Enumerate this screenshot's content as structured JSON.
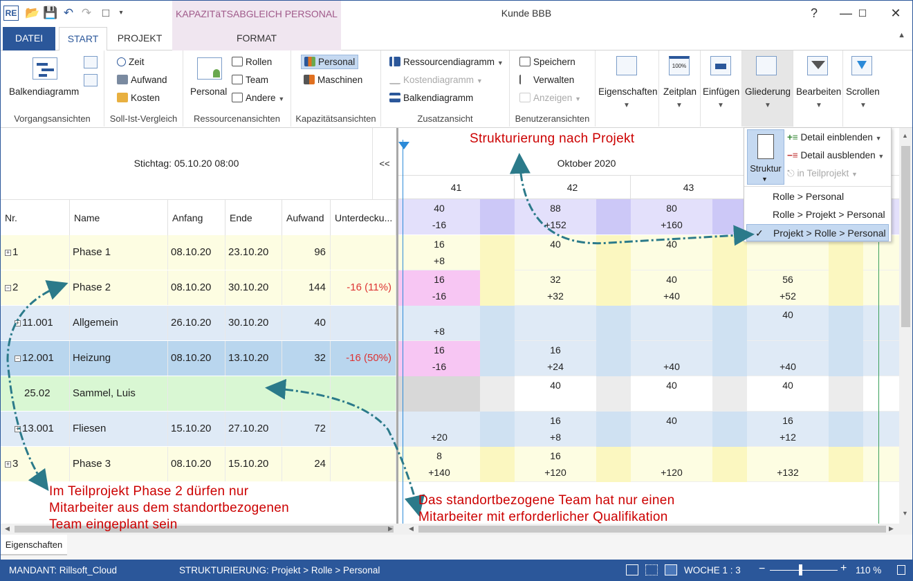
{
  "window": {
    "title": "Kunde BBB",
    "context_tab_title": "KAPAZITäTSABGLEICH PERSONAL"
  },
  "tabs": [
    "DATEI",
    "START",
    "PROJEKT",
    "FORMAT"
  ],
  "ribbon": {
    "vorgangsansichten": {
      "label": "Vorgangsansichten",
      "balken": "Balkendiagramm"
    },
    "soll_ist": {
      "label": "Soll-Ist-Vergleich",
      "zeit": "Zeit",
      "aufwand": "Aufwand",
      "kosten": "Kosten"
    },
    "ressourcen": {
      "label": "Ressourcenansichten",
      "personal": "Personal",
      "rollen": "Rollen",
      "team": "Team",
      "andere": "Andere"
    },
    "kapazitaet": {
      "label": "Kapazitätsansichten",
      "personal": "Personal",
      "maschinen": "Maschinen"
    },
    "zusatz": {
      "label": "Zusatzansicht",
      "ressourcendiagramm": "Ressourcendiagramm",
      "kostendiagramm": "Kostendiagramm",
      "balkendiagramm": "Balkendiagramm"
    },
    "benutzer": {
      "label": "Benutzeransichten",
      "speichern": "Speichern",
      "verwalten": "Verwalten",
      "anzeigen": "Anzeigen"
    },
    "big_buttons": [
      "Eigenschaften",
      "Zeitplan",
      "Einfügen",
      "Gliederung",
      "Bearbeiten",
      "Scrollen"
    ]
  },
  "grid": {
    "stichtag": "Stichtag: 05.10.20 08:00",
    "collapse": "<<",
    "columns": [
      "Nr.",
      "Name",
      "Anfang",
      "Ende",
      "Aufwand",
      "Unterdecku..."
    ],
    "rows": [
      {
        "nr": "1",
        "name": "Phase 1",
        "anfang": "08.10.20",
        "ende": "23.10.20",
        "aufwand": "96",
        "unter": ""
      },
      {
        "nr": "2",
        "name": "Phase 2",
        "anfang": "08.10.20",
        "ende": "30.10.20",
        "aufwand": "144",
        "unter": "-16 (11%)"
      },
      {
        "nr": "11.001",
        "name": "Allgemein",
        "anfang": "26.10.20",
        "ende": "30.10.20",
        "aufwand": "40",
        "unter": ""
      },
      {
        "nr": "12.001",
        "name": "Heizung",
        "anfang": "08.10.20",
        "ende": "13.10.20",
        "aufwand": "32",
        "unter": "-16 (50%)"
      },
      {
        "nr": "25.02",
        "name": "Sammel, Luis",
        "anfang": "",
        "ende": "",
        "aufwand": "",
        "unter": ""
      },
      {
        "nr": "13.001",
        "name": "Fliesen",
        "anfang": "15.10.20",
        "ende": "27.10.20",
        "aufwand": "72",
        "unter": ""
      },
      {
        "nr": "3",
        "name": "Phase 3",
        "anfang": "08.10.20",
        "ende": "15.10.20",
        "aufwand": "24",
        "unter": ""
      }
    ]
  },
  "timeline": {
    "month": "Oktober 2020",
    "weeks": [
      "41",
      "42",
      "43"
    ],
    "summary": [
      [
        "40",
        "-16"
      ],
      [
        "88",
        "+152"
      ],
      [
        "80",
        "+160"
      ]
    ],
    "rows": [
      [
        [
          "16",
          "+8"
        ],
        [
          "40",
          ""
        ],
        [
          "40",
          ""
        ],
        [
          "",
          ""
        ]
      ],
      [
        [
          "16",
          "-16"
        ],
        [
          "32",
          "+32"
        ],
        [
          "40",
          "+40"
        ],
        [
          "56",
          "+52"
        ]
      ],
      [
        [
          "",
          "+8"
        ],
        [
          "",
          ""
        ],
        [
          "",
          ""
        ],
        [
          "40",
          ""
        ]
      ],
      [
        [
          "16",
          "-16"
        ],
        [
          "16",
          "+24"
        ],
        [
          "",
          "+40"
        ],
        [
          "",
          "+40"
        ]
      ],
      [
        [
          "",
          ""
        ],
        [
          "40",
          ""
        ],
        [
          "40",
          ""
        ],
        [
          "40",
          ""
        ]
      ],
      [
        [
          "",
          "+20"
        ],
        [
          "16",
          "+8"
        ],
        [
          "40",
          ""
        ],
        [
          "16",
          "+12"
        ]
      ],
      [
        [
          "8",
          "+140"
        ],
        [
          "16",
          "+120"
        ],
        [
          "",
          "+120"
        ],
        [
          "",
          "+132"
        ]
      ]
    ]
  },
  "gliederung_menu": {
    "struktur": "Struktur",
    "detail_einblenden": "Detail einblenden",
    "detail_ausblenden": "Detail ausblenden",
    "in_teilprojekt": "in Teilprojekt",
    "options": [
      "Rolle > Personal",
      "Rolle > Projekt > Personal",
      "Projekt > Rolle > Personal"
    ],
    "selected": "Projekt > Rolle > Personal"
  },
  "annotations": {
    "top": "Strukturierung nach Projekt",
    "left": [
      "Im Teilprojekt Phase 2 dürfen nur",
      "Mitarbeiter aus dem standortbezogenen",
      "Team eingeplant sein"
    ],
    "right": [
      "Das standortbezogene Team hat nur einen",
      "Mitarbeiter mit erforderlicher Qualifikation"
    ]
  },
  "properties_tab": "Eigenschaften",
  "status": {
    "mandant": "MANDANT: Rillsoft_Cloud",
    "strukturierung": "STRUKTURIERUNG: Projekt > Rolle > Personal",
    "woche": "WOCHE 1 : 3",
    "zoom": "110 %"
  },
  "colors": {
    "accent": "#2b579a",
    "phase_row": "#fdfde2",
    "sub_row": "#dfeaf6",
    "selected_row": "#b9d6ee",
    "person_row": "#d9f7d3",
    "summary_row": "#e3e0fb",
    "shortage": "#f7c6f3",
    "annotation": "#cc0000",
    "arrow": "#2b7a8a"
  }
}
